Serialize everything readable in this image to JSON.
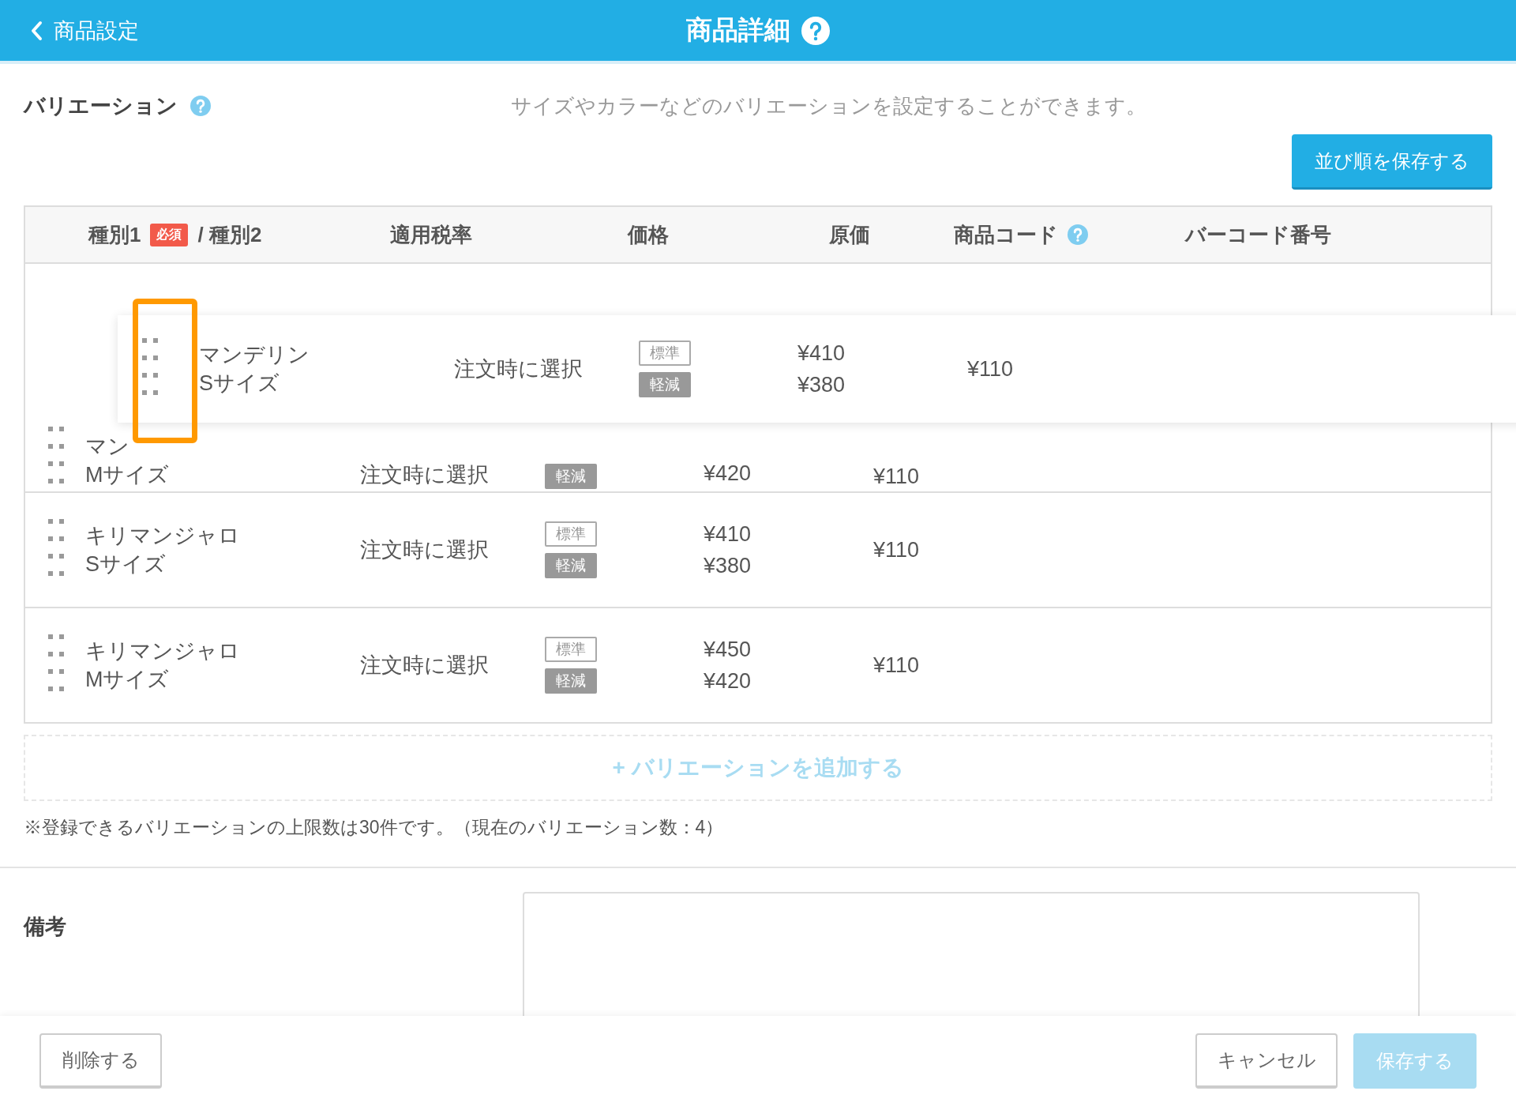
{
  "header": {
    "back_label": "商品設定",
    "title": "商品詳細"
  },
  "variations": {
    "title": "バリエーション",
    "description": "サイズやカラーなどのバリエーションを設定することができます。",
    "save_order_button": "並び順を保存する",
    "columns": [
      {
        "label": "種別1",
        "badge": "必須",
        "label2": "/ 種別2"
      },
      {
        "label": "適用税率"
      },
      {
        "label": "価格"
      },
      {
        "label": "原価"
      },
      {
        "label": "商品コード",
        "help": true
      },
      {
        "label": "バーコード番号"
      }
    ],
    "dragged_row": {
      "name_lines": [
        "マンデリン",
        "Sサイズ"
      ],
      "tax": "注文時に選択",
      "badges": [
        {
          "label": "標準",
          "kind": "standard"
        },
        {
          "label": "軽減",
          "kind": "reduced"
        }
      ],
      "prices": [
        "¥410",
        "¥380"
      ],
      "cost": "¥110"
    },
    "rows": [
      {
        "kind": "under_drag",
        "name_lines": [
          "マン",
          "Mサイズ"
        ],
        "tax": "注文時に選択",
        "badges": [
          {
            "label": "軽減",
            "kind": "reduced"
          }
        ],
        "prices": [
          "¥420"
        ],
        "cost": "¥110"
      },
      {
        "kind": "normal",
        "name_lines": [
          "キリマンジャロ",
          "Sサイズ"
        ],
        "tax": "注文時に選択",
        "badges": [
          {
            "label": "標準",
            "kind": "standard"
          },
          {
            "label": "軽減",
            "kind": "reduced"
          }
        ],
        "prices": [
          "¥410",
          "¥380"
        ],
        "cost": "¥110"
      },
      {
        "kind": "normal",
        "name_lines": [
          "キリマンジャロ",
          "Mサイズ"
        ],
        "tax": "注文時に選択",
        "badges": [
          {
            "label": "標準",
            "kind": "standard"
          },
          {
            "label": "軽減",
            "kind": "reduced"
          }
        ],
        "prices": [
          "¥450",
          "¥420"
        ],
        "cost": "¥110"
      }
    ],
    "add_button": "+ バリエーションを追加する",
    "note": "※登録できるバリエーションの上限数は30件です。（現在のバリエーション数：4）"
  },
  "remarks": {
    "label": "備考"
  },
  "footer": {
    "buttons": [
      {
        "label": "削除する",
        "kind": "delete",
        "disabled": false
      },
      {
        "label": "キャンセル",
        "kind": "cancel",
        "disabled": false
      },
      {
        "label": "保存する",
        "kind": "primary",
        "disabled": true
      }
    ]
  }
}
